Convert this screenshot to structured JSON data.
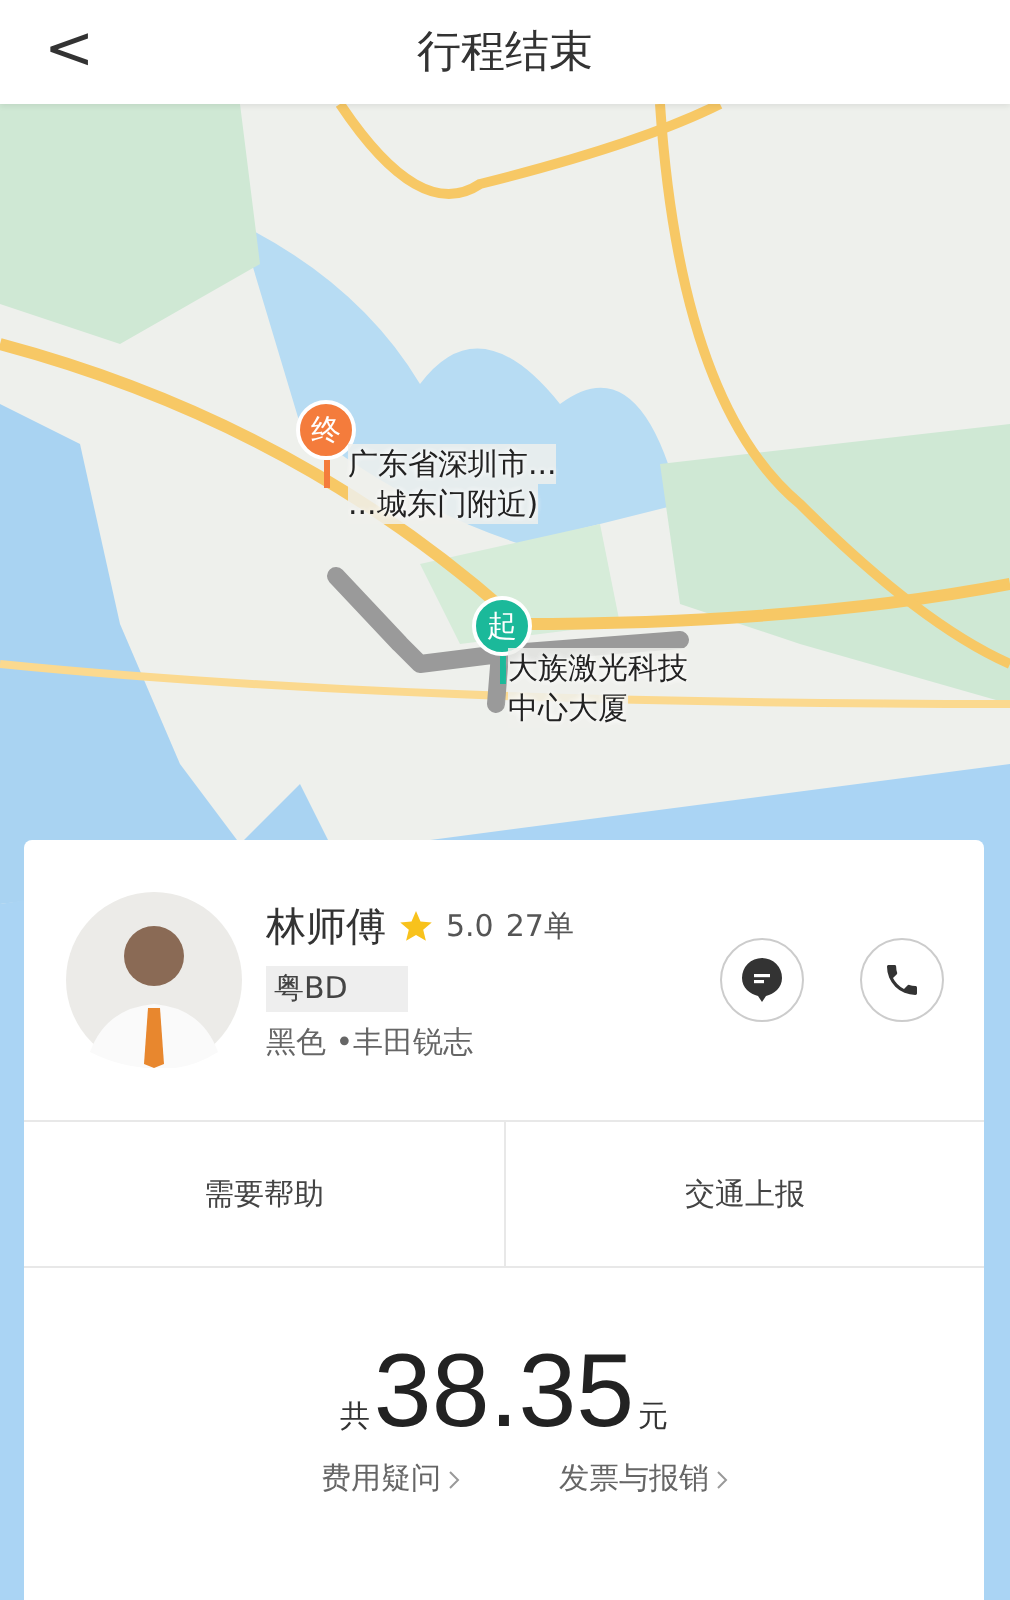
{
  "header": {
    "back": "<",
    "title": "行程结束"
  },
  "map": {
    "markers": [
      {
        "kind": "end",
        "glyph": "终",
        "label": [
          "广东省深圳市...",
          "...城东门附近)"
        ],
        "color": "#f47c3c"
      },
      {
        "kind": "start",
        "glyph": "起",
        "label": [
          "大族激光科技",
          "中心大厦"
        ],
        "color": "#1bb99a"
      }
    ]
  },
  "driver": {
    "name": "林师傅",
    "rating": "5.0",
    "orders": "27单",
    "plate": "粤BD",
    "car": "黑色 •丰田锐志"
  },
  "actions": [
    "需要帮助",
    "交通上报"
  ],
  "fare": {
    "prefix": "共",
    "amount": "38.35",
    "unit": "元",
    "links": [
      "费用疑问",
      "发票与报销"
    ]
  }
}
